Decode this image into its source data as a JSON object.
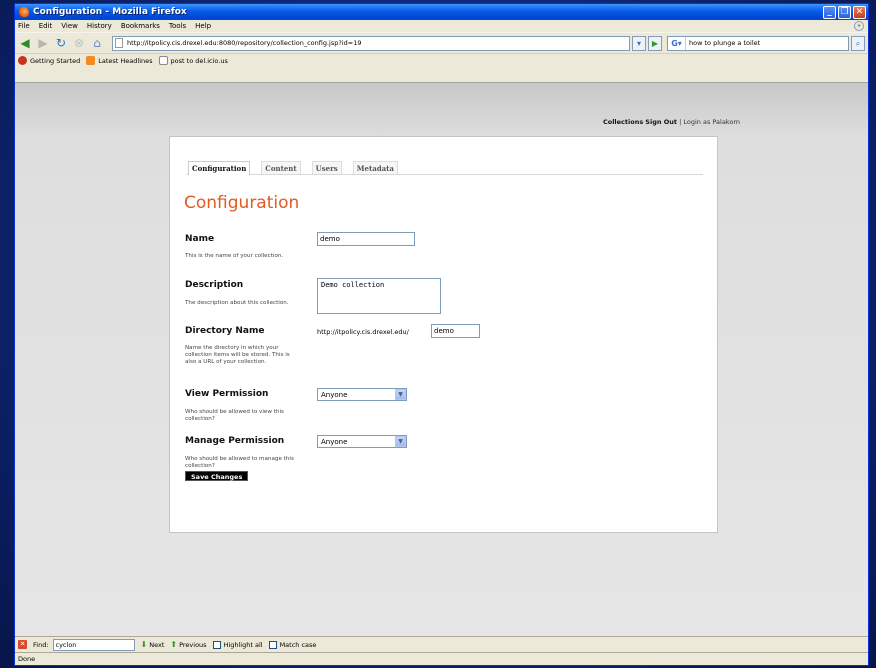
{
  "window": {
    "title": "Configuration - Mozilla Firefox",
    "buttons": [
      "_",
      "❐",
      "✕"
    ]
  },
  "menubar": {
    "items": [
      "File",
      "Edit",
      "View",
      "History",
      "Bookmarks",
      "Tools",
      "Help"
    ]
  },
  "navbar": {
    "url": "http://itpolicy.cis.drexel.edu:8080/repository/collection_config.jsp?id=19",
    "search_value": "how to plunge a toilet"
  },
  "bookmarks": {
    "items": [
      "Getting Started",
      "Latest Headlines",
      "post to del.icio.us"
    ]
  },
  "page": {
    "toplinks": {
      "collections": "Collections",
      "signout": "Sign Out",
      "separator": "|",
      "login": "Login as Palakorn"
    },
    "tabs": [
      "Configuration",
      "Content",
      "Users",
      "Metadata"
    ],
    "title": "Configuration",
    "fields": {
      "name": {
        "label": "Name",
        "help": "This is the name of your collection.",
        "value": "demo"
      },
      "description": {
        "label": "Description",
        "help": "The description about this collection.",
        "value": "Demo collection"
      },
      "directory": {
        "label": "Directory Name",
        "help": "Name the directory in which your collection items will be stored. This is also a URL of your collection.",
        "prefix": "http://itpolicy.cis.drexel.edu/",
        "value": "demo"
      },
      "view_permission": {
        "label": "View Permission",
        "help": "Who should be allowed to view this collection?",
        "value": "Anyone"
      },
      "manage_permission": {
        "label": "Manage Permission",
        "help": "Who should be allowed to manage this collection?",
        "value": "Anyone"
      }
    },
    "save_label": "Save Changes"
  },
  "findbar": {
    "label": "Find:",
    "value": "cyclon",
    "next": "Next",
    "previous": "Previous",
    "highlight": "Highlight all",
    "matchcase": "Match case"
  },
  "status": "Done",
  "colors": {
    "accent": "#e05a22",
    "titlebar": "#0a5fe8"
  }
}
